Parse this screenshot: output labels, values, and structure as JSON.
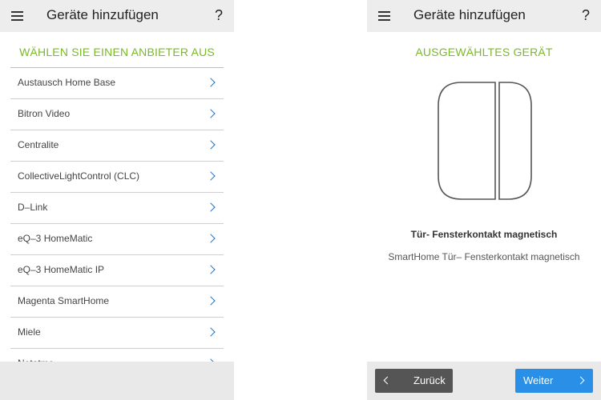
{
  "left": {
    "appbar": {
      "menu_icon": "menu-icon",
      "title": "Geräte hinzufügen",
      "help": "?"
    },
    "section_title": "WÄHLEN SIE EINEN ANBIETER AUS",
    "providers": [
      "Austausch Home Base",
      "Bitron Video",
      "Centralite",
      "CollectiveLightControl (CLC)",
      "D–Link",
      "eQ–3 HomeMatic",
      "eQ–3 HomeMatic IP",
      "Magenta SmartHome",
      "Miele",
      "Netatmo"
    ]
  },
  "right": {
    "appbar": {
      "menu_icon": "menu-icon",
      "title": "Geräte hinzufügen",
      "help": "?"
    },
    "section_title": "AUSGEWÄHLTES GERÄT",
    "device_name": "Tür- Fensterkontakt magnetisch",
    "device_description": "SmartHome Tür– Fensterkontakt magnetisch",
    "back_label": "Zurück",
    "next_label": "Weiter"
  },
  "colors": {
    "accent_green": "#7ab929",
    "link_blue": "#1a73c8",
    "next_button": "#2a8fe6",
    "back_button": "#555555"
  }
}
